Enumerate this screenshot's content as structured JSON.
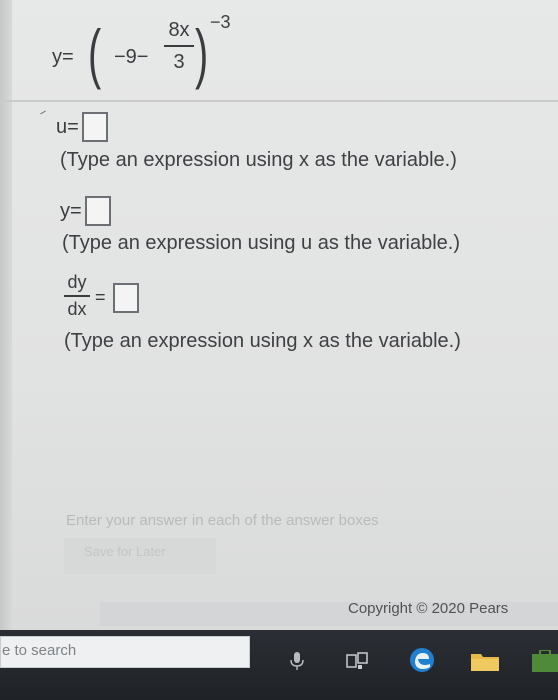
{
  "header_equation": {
    "y_label": "y=",
    "paren_open": "(",
    "inner": "−9−",
    "fraction": {
      "numerator": "8x",
      "denominator": "3"
    },
    "paren_close": ")",
    "exponent": "−3"
  },
  "answers": [
    {
      "label": "u=",
      "hint": "(Type an expression using x as the variable.)"
    },
    {
      "label": "y=",
      "hint": "(Type an expression using u as the variable.)"
    },
    {
      "label_num": "dy",
      "label_den": "dx",
      "equals": "=",
      "hint": "(Type an expression using x as the variable.)"
    }
  ],
  "status_message": "Enter your answer in each of the answer boxes",
  "save_button": "Save for Later",
  "copyright": "Copyright © 2020 Pears",
  "taskbar": {
    "search_text": "e to search",
    "icons": [
      "microphone-icon",
      "task-view-icon",
      "edge-browser-icon",
      "file-explorer-icon",
      "store-icon"
    ]
  },
  "colors": {
    "edge_blue": "#1f7fd0",
    "explorer_yellow": "#e8b74a",
    "store_green": "#4e8a3a"
  }
}
